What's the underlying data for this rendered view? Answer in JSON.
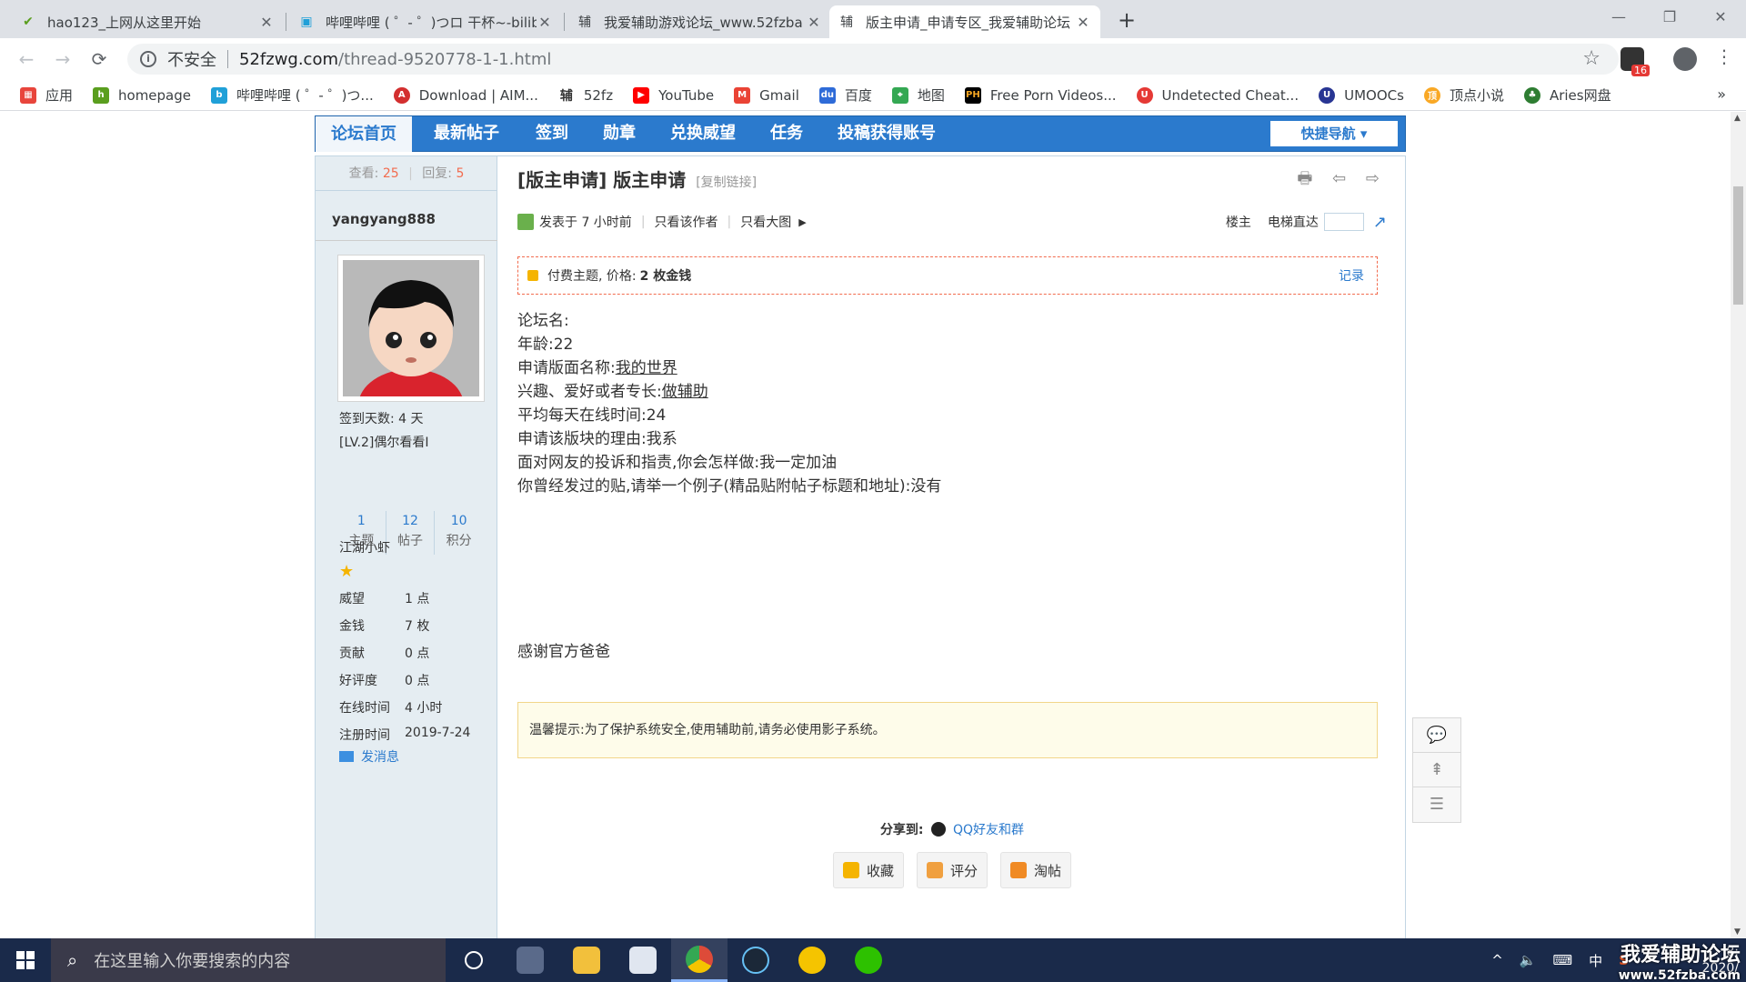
{
  "browser": {
    "tabs": [
      {
        "title": "hao123_上网从这里开始",
        "close": "✕"
      },
      {
        "title": "哔哩哔哩 ( ゜- ゜)つロ 干杯~-bilibili",
        "close": "✕"
      },
      {
        "title": "我爱辅助游戏论坛_www.52fzba",
        "close": "✕"
      },
      {
        "title": "版主申请_申请专区_我爱辅助论坛",
        "close": "✕"
      }
    ],
    "new_tab": "+",
    "window_controls": {
      "minimize": "—",
      "maximize": "❐",
      "close": "✕"
    },
    "back": "←",
    "forward": "→",
    "reload": "⟳",
    "security_label": "不安全",
    "url_host": "52fzwg.com",
    "url_path": "/thread-9520778-1-1.html",
    "bookmark_star": "☆",
    "extension_badge": "16",
    "bookmarks": [
      {
        "label": "应用",
        "color": "#e8453c"
      },
      {
        "label": "homepage",
        "color": "#5a9e1e"
      },
      {
        "label": "哔哩哔哩 ( ゜- ゜)つ...",
        "color": "#20a0d8"
      },
      {
        "label": "Download | AIM...",
        "color": "#d32f2f"
      },
      {
        "label": "52fz",
        "color": "#333333"
      },
      {
        "label": "YouTube",
        "color": "#ff0000"
      },
      {
        "label": "Gmail",
        "color": "#ea4335"
      },
      {
        "label": "百度",
        "color": "#2e6bd8"
      },
      {
        "label": "地图",
        "color": "#34a853"
      },
      {
        "label": "Free Porn Videos...",
        "color": "#f5a623"
      },
      {
        "label": "Undetected Cheat...",
        "color": "#e53935"
      },
      {
        "label": "UMOOCs",
        "color": "#283593"
      },
      {
        "label": "顶点小说",
        "color": "#f9a825"
      },
      {
        "label": "Aries网盘",
        "color": "#2e7d32"
      }
    ],
    "bookmarks_more": "»"
  },
  "forum_nav": {
    "items": [
      "论坛首页",
      "最新帖子",
      "签到",
      "勋章",
      "兑换威望",
      "任务",
      "投稿获得账号"
    ],
    "quick_nav": "快捷导航 ▾"
  },
  "sidebar": {
    "views_label": "查看:",
    "views": "25",
    "replies_label": "回复:",
    "replies": "5",
    "author": "yangyang888",
    "sign_days": "签到天数: 4 天",
    "level": "[LV.2]偶尔看看I",
    "counts": [
      {
        "num": "1",
        "label": "主题"
      },
      {
        "num": "12",
        "label": "帖子"
      },
      {
        "num": "10",
        "label": "积分"
      }
    ],
    "rank": "江湖小虾",
    "fields": [
      {
        "label": "威望",
        "value": "1 点"
      },
      {
        "label": "金钱",
        "value": "7 枚"
      },
      {
        "label": "贡献",
        "value": "0 点"
      },
      {
        "label": "好评度",
        "value": "0 点"
      },
      {
        "label": "在线时间",
        "value": "4 小时"
      },
      {
        "label": "注册时间",
        "value": "2019-7-24"
      }
    ],
    "send_message": "发消息"
  },
  "post": {
    "title": "[版主申请] 版主申请",
    "copy_link": "[复制链接]",
    "tools": "🖶 ⇦ ⇨",
    "posted": "发表于 7 小时前",
    "only_author": "只看该作者",
    "only_big": "只看大图",
    "floor": "楼主",
    "elevator": "电梯直达",
    "paid_text": "付费主题, 价格:",
    "paid_price": "2 枚金钱",
    "paid_record": "记录",
    "body": [
      {
        "text": "论坛名:",
        "u": ""
      },
      {
        "text": "年龄:22",
        "u": ""
      },
      {
        "text": "申请版面名称:",
        "u": "我的世界"
      },
      {
        "text": "兴趣、爱好或者专长:",
        "u": "做辅助"
      },
      {
        "text": "平均每天在线时间:24",
        "u": ""
      },
      {
        "text": "申请该版块的理由:我系",
        "u": ""
      },
      {
        "text": "面对网友的投诉和指责,你会怎样做:我一定加油",
        "u": ""
      },
      {
        "text": "你曾经发过的贴,请举一个例子(精品贴附帖子标题和地址):没有",
        "u": ""
      }
    ],
    "thanks": "感谢官方爸爸",
    "tip": "温馨提示:为了保护系统安全,使用辅助前,请务必使用影子系统。",
    "share_label": "分享到:",
    "share_qq": "QQ好友和群",
    "actions": [
      {
        "label": "收藏",
        "color": "#f5b400"
      },
      {
        "label": "评分",
        "color": "#f0a040"
      },
      {
        "label": "淘帖",
        "color": "#f08a24"
      }
    ]
  },
  "float_tools": [
    "💬",
    "⇞",
    "☰"
  ],
  "taskbar": {
    "search_placeholder": "在这里输入你要搜索的内容",
    "apps": [
      {
        "name": "cortana",
        "color": "#1a2a4a"
      },
      {
        "name": "task-view",
        "color": "#5a6a8a"
      },
      {
        "name": "file-explorer",
        "color": "#f2c03c"
      },
      {
        "name": "network-app",
        "color": "#e0e6f0"
      },
      {
        "name": "chrome",
        "color": "#dd4b39"
      },
      {
        "name": "steam",
        "color": "#1b2838"
      },
      {
        "name": "music",
        "color": "#f5c400"
      },
      {
        "name": "wechat",
        "color": "#2dc100"
      }
    ],
    "tray": [
      "^",
      "🔈",
      "⌨",
      "中",
      "S"
    ],
    "clock": "8:",
    "date": "2020/"
  },
  "watermark": {
    "title": "我爱辅助论坛",
    "url": "www.52fzba.com"
  }
}
